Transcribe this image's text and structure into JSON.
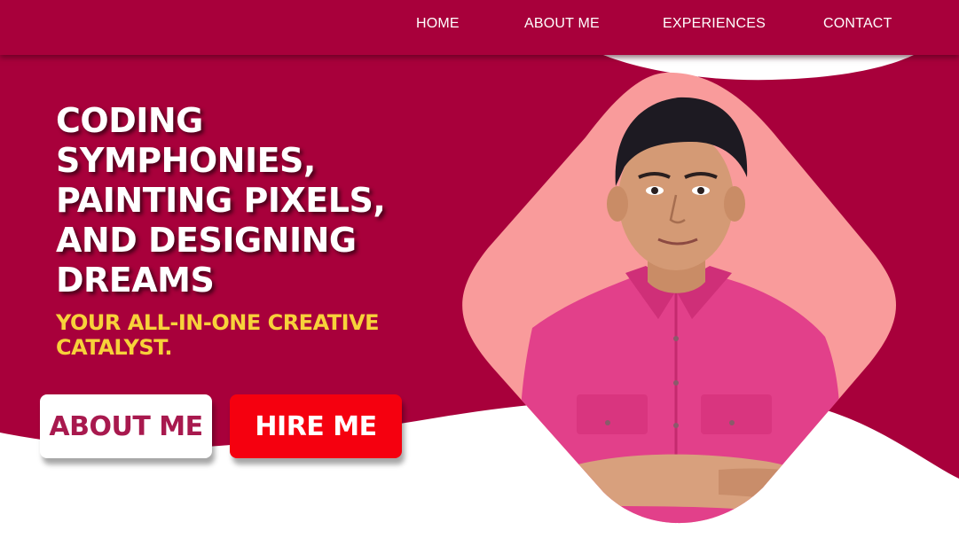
{
  "nav": {
    "items": [
      {
        "label": "HOME"
      },
      {
        "label": "ABOUT ME"
      },
      {
        "label": "EXPERIENCES"
      },
      {
        "label": "CONTACT"
      }
    ]
  },
  "hero": {
    "headline": "CODING SYMPHONIES, PAINTING PIXELS, AND DESIGNING DREAMS",
    "tagline": "YOUR ALL-IN-ONE CREATIVE CATALYST.",
    "about_button_label": "ABOUT ME",
    "hire_button_label": "HIRE ME"
  },
  "colors": {
    "brand": "#a8003b",
    "accent_yellow": "#f7d23a",
    "hire_red": "#f5000f",
    "photo_backdrop": "#f99b9b",
    "shirt_pink": "#e2408a"
  },
  "icons": {
    "portrait": "portrait-photo"
  }
}
